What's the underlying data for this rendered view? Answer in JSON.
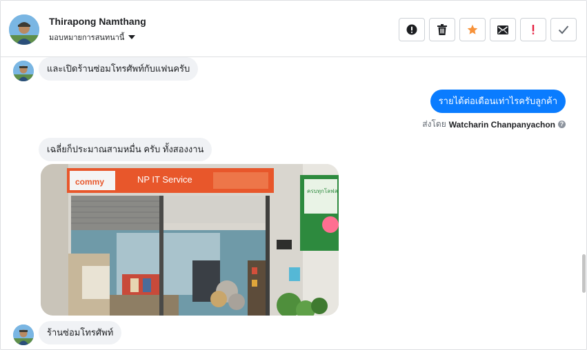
{
  "header": {
    "name": "Thirapong Namthang",
    "assign_label": "มอบหมายการสนทนานี้"
  },
  "actions": [
    {
      "icon": "alert-icon",
      "label": "Mark as spam"
    },
    {
      "icon": "trash-icon",
      "label": "Delete"
    },
    {
      "icon": "star-icon",
      "label": "Star"
    },
    {
      "icon": "mail-icon",
      "label": "Mark as unread"
    },
    {
      "icon": "exclamation-icon",
      "label": "Flag"
    },
    {
      "icon": "check-icon",
      "label": "Mark as done"
    }
  ],
  "messages": {
    "m1": "และเปิดร้านซ่อมโทรศัพท์กับแฟนครับ",
    "m2": "รายได้ต่อเดือนเท่าไรครับลูกค้า",
    "sent_by_prefix": "ส่งโดย",
    "sent_by_name": "Watcharin Chanpanyachon",
    "m3": "เฉลี่ยก็ประมาณสามหมื่น ครับ ทั้งสองงาน",
    "m4": "ร้านซ่อมโทรศัพท์"
  },
  "photo": {
    "sign_brand": "commy",
    "sign_title": "NP IT Service",
    "side_sign": "ครบทุกโลฟสไตล์"
  },
  "colors": {
    "outgoing_bubble": "#0a7cff",
    "incoming_bubble": "#f0f2f5",
    "star": "#f7923a",
    "flag": "#e41e3f"
  }
}
